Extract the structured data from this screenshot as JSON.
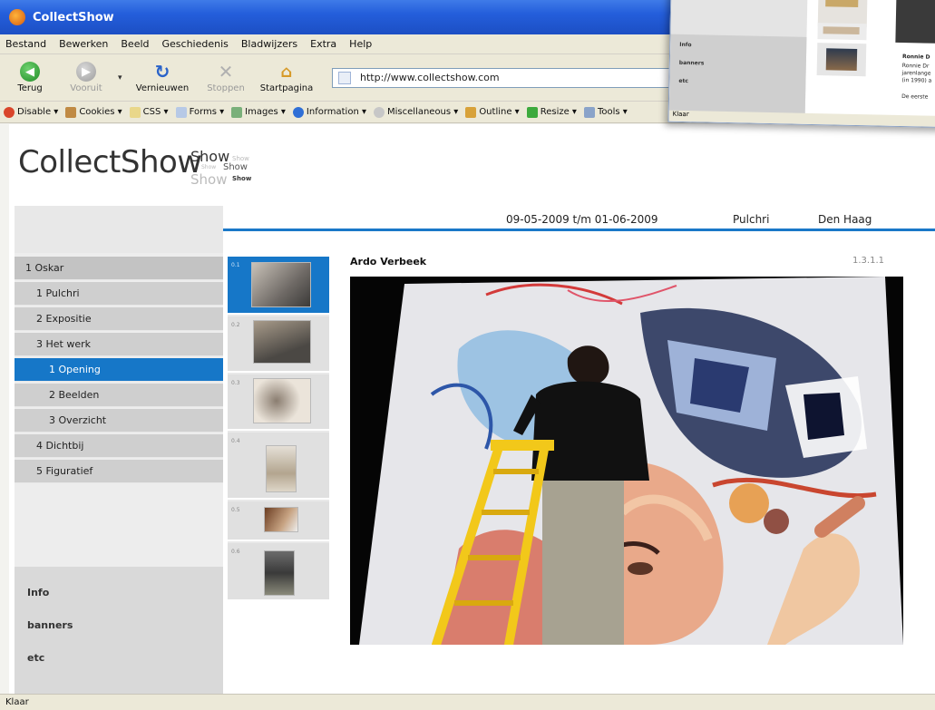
{
  "window": {
    "title": "CollectShow"
  },
  "menu": [
    "Bestand",
    "Bewerken",
    "Beeld",
    "Geschiedenis",
    "Bladwijzers",
    "Extra",
    "Help"
  ],
  "toolbar": {
    "back": "Terug",
    "forward": "Vooruit",
    "reload": "Vernieuwen",
    "stop": "Stoppen",
    "home": "Startpagina"
  },
  "url": "http://www.collectshow.com",
  "devtools": [
    "Disable",
    "Cookies",
    "CSS",
    "Forms",
    "Images",
    "Information",
    "Miscellaneous",
    "Outline",
    "Resize",
    "Tools"
  ],
  "site": {
    "logo": "CollectShow",
    "logo_stack": [
      "Show",
      "Show",
      "Show",
      "Show",
      "Show"
    ],
    "date_range": "09-05-2009 t/m 01-06-2009",
    "venue": "Pulchri",
    "city": "Den Haag"
  },
  "nav": [
    {
      "label": "1 Oskar",
      "level": 1,
      "active": false
    },
    {
      "label": "1 Pulchri",
      "level": 2,
      "active": false
    },
    {
      "label": "2 Expositie",
      "level": 2,
      "active": false
    },
    {
      "label": "3 Het werk",
      "level": 2,
      "active": false
    },
    {
      "label": "1 Opening",
      "level": 3,
      "active": true
    },
    {
      "label": "2 Beelden",
      "level": 3,
      "active": false
    },
    {
      "label": "3 Overzicht",
      "level": 3,
      "active": false
    },
    {
      "label": "4 Dichtbij",
      "level": 2,
      "active": false
    },
    {
      "label": "5 Figuratief",
      "level": 2,
      "active": false
    }
  ],
  "side_links": [
    "Info",
    "banners",
    "etc"
  ],
  "thumbnails": [
    {
      "num": "0.1",
      "active": true
    },
    {
      "num": "0.2",
      "active": false
    },
    {
      "num": "0.3",
      "active": false
    },
    {
      "num": "0.4",
      "active": false
    },
    {
      "num": "0.5",
      "active": false
    },
    {
      "num": "0.6",
      "active": false
    }
  ],
  "artwork": {
    "artist": "Ardo Verbeek",
    "code": "1.3.1.1"
  },
  "status": "Klaar",
  "inset": {
    "links": [
      "Info",
      "banners",
      "etc"
    ],
    "status": "Klaar",
    "text_lines": [
      "Ronnie D",
      "Ronnie Dr",
      "jarenlange",
      "(in 1990) a",
      "De eerste"
    ]
  },
  "colors": {
    "accent": "#1677c8",
    "titlebar": "#245edb"
  }
}
